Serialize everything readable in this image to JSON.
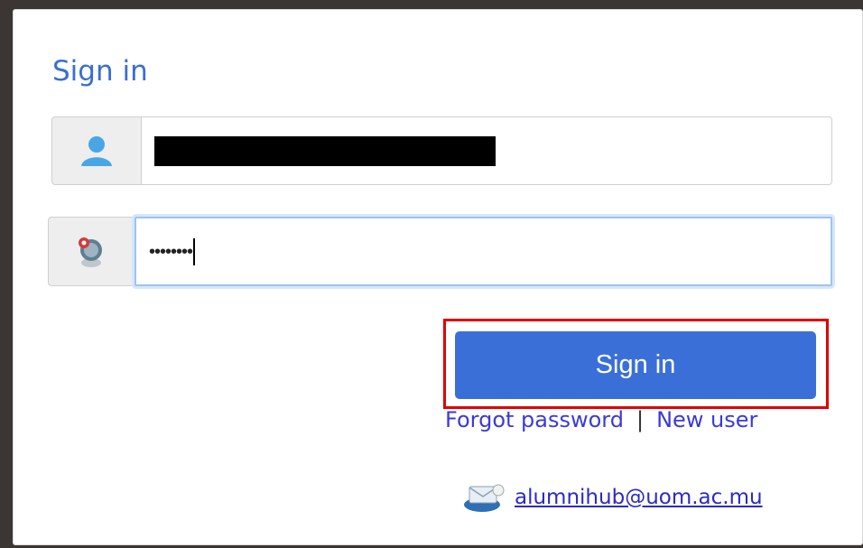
{
  "form": {
    "title": "Sign in",
    "username": {
      "value": ""
    },
    "password": {
      "masked_value": "••••••••"
    },
    "submit_label": "Sign in"
  },
  "links": {
    "forgot_password": "Forgot password",
    "separator": "|",
    "new_user": "New user"
  },
  "contact": {
    "email": "alumnihub@uom.ac.mu",
    "icon": "mail-icon"
  },
  "colors": {
    "title": "#3a6fd0",
    "button_bg": "#3b6fd8",
    "highlight": "#e00000",
    "link": "#3a3adb"
  }
}
